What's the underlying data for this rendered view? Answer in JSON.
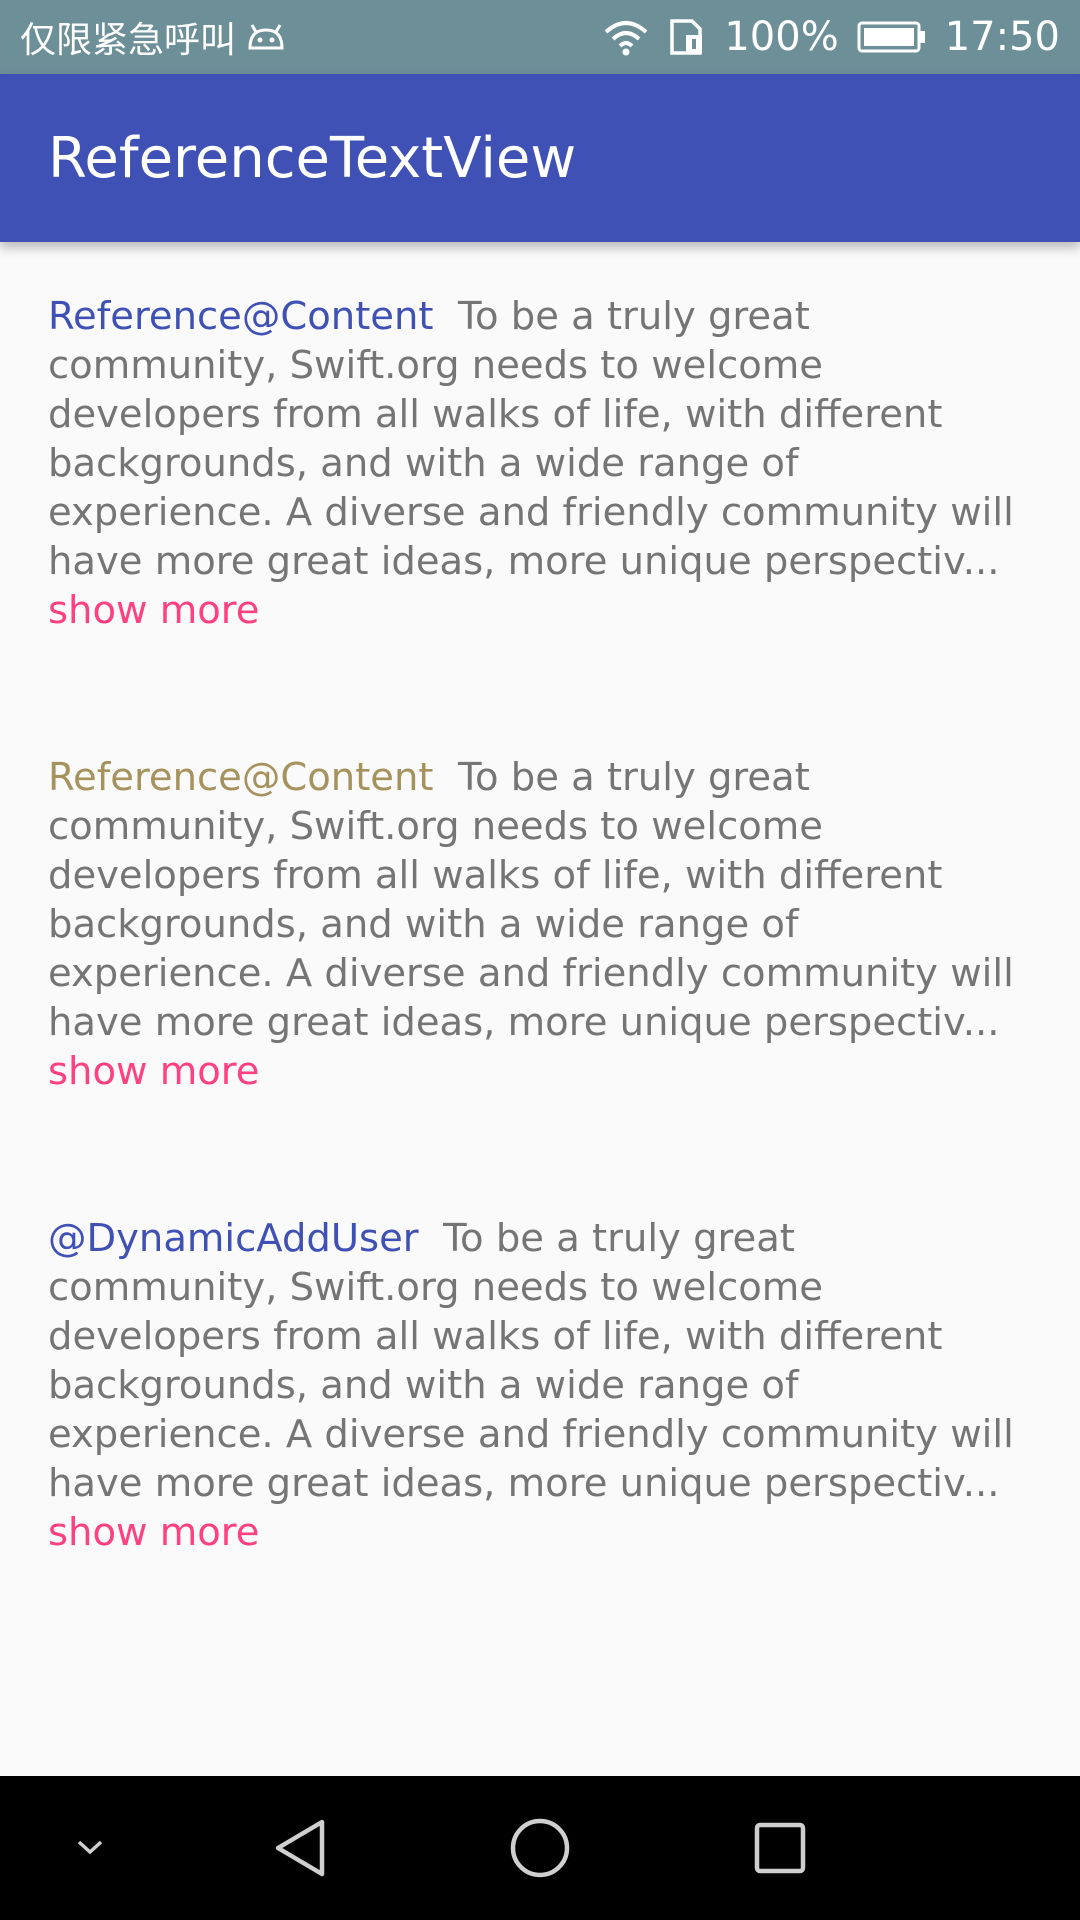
{
  "status_bar": {
    "carrier": "仅限紧急呼叫",
    "battery": "100%",
    "time": "17:50",
    "icons": [
      "android-icon",
      "wifi-icon",
      "sim-icon",
      "battery-icon"
    ]
  },
  "app_bar": {
    "title": "ReferenceTextView",
    "color": "#3f51b5"
  },
  "items": [
    {
      "reference": "Reference@Content",
      "reference_color": "#3f51b5",
      "body": "To be a truly great community, Swift.org needs to welcome developers from all walks of life, with different backgrounds, and with a wide range of experience. A diverse and friendly community will have more great ideas, more unique perspectiv...",
      "show_more": "show more"
    },
    {
      "reference": "Reference@Content",
      "reference_color": "#a6925c",
      "body": "To be a truly great community, Swift.org needs to welcome developers from all walks of life, with different backgrounds, and with a wide range of experience. A diverse and friendly community will have more great ideas, more unique perspectiv...",
      "show_more": "show more"
    },
    {
      "reference": "@DynamicAddUser",
      "reference_color": "#3f51b5",
      "body": "To be a truly great community, Swift.org needs to welcome developers from all walks of life, with different backgrounds, and with a wide range of experience. A diverse and friendly community will have more great ideas, more unique perspectiv...",
      "show_more": "show more"
    }
  ],
  "nav_bar": {
    "icons": [
      "chevron-down-icon",
      "back-icon",
      "home-icon",
      "recents-icon"
    ]
  },
  "colors": {
    "status_bar": "#6c8f98",
    "show_more": "#ff4081",
    "body_text": "#757575"
  }
}
